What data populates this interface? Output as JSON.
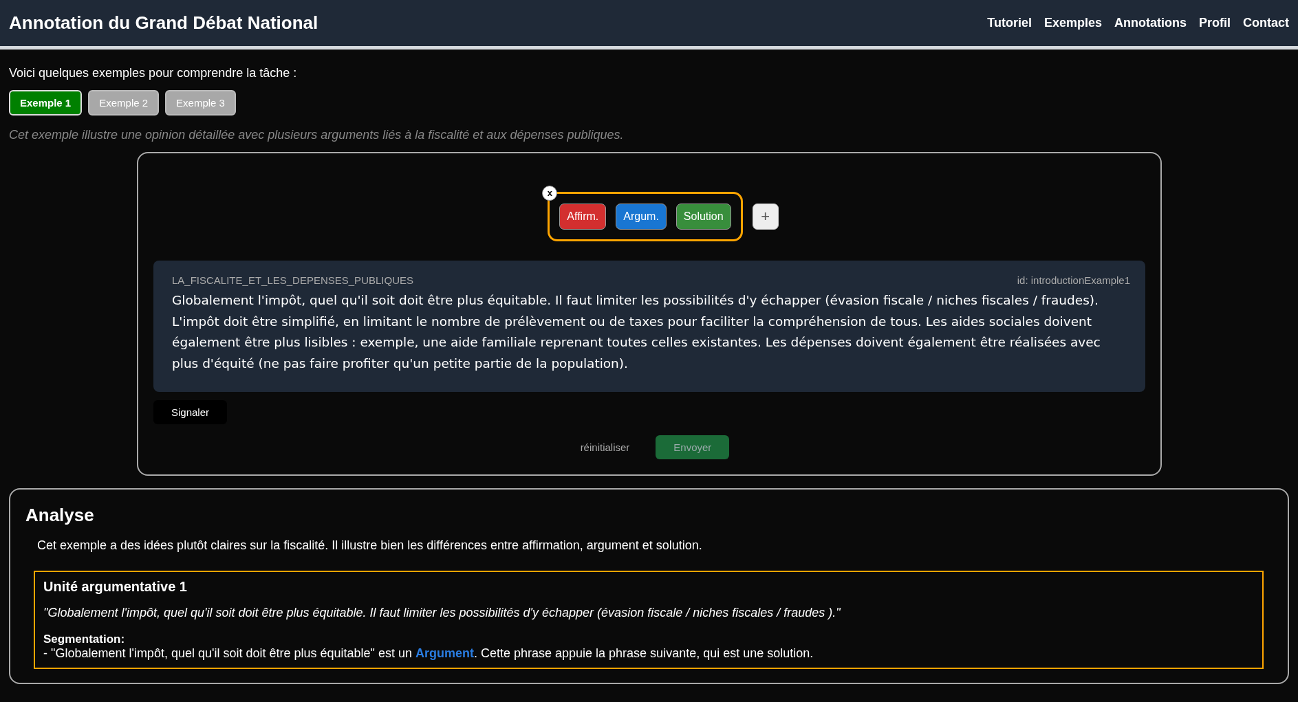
{
  "header": {
    "title": "Annotation du Grand Débat National",
    "nav": [
      "Tutoriel",
      "Exemples",
      "Annotations",
      "Profil",
      "Contact"
    ]
  },
  "intro": "Voici quelques exemples pour comprendre la tâche :",
  "examples": [
    {
      "label": "Exemple 1",
      "selected": true
    },
    {
      "label": "Exemple 2",
      "selected": false
    },
    {
      "label": "Exemple 3",
      "selected": false
    }
  ],
  "description": "Cet exemple illustre une opinion détaillée avec plusieurs arguments liés à la fiscalité et aux dépenses publiques.",
  "annotator": {
    "close": "x",
    "labels": [
      {
        "label": "Affirm.",
        "color": "#d32f2f"
      },
      {
        "label": "Argum.",
        "color": "#1976d2"
      },
      {
        "label": "Solution",
        "color": "#388e3c"
      }
    ],
    "add": "+",
    "category": "LA_FISCALITE_ET_LES_DEPENSES_PUBLIQUES",
    "id": "id: introductionExample1",
    "text": "Globalement l'impôt, quel qu'il soit doit être plus équitable. Il faut limiter les possibilités d'y échapper (évasion fiscale / niches fiscales / fraudes). L'impôt doit être simplifié, en limitant le nombre de prélèvement ou de taxes pour faciliter la compréhension de tous. Les aides sociales doivent également être plus lisibles : exemple, une aide familiale reprenant toutes celles existantes. Les dépenses doivent également être réalisées avec plus d'équité (ne pas faire profiter qu'un petite partie de la population).",
    "report": "Signaler",
    "reset": "réinitialiser",
    "submit": {
      "label": "Envoyer",
      "disabled": true
    }
  },
  "analysis": {
    "title": "Analyse",
    "summary": "Cet exemple a des idées plutôt claires sur la fiscalité. Il illustre bien les différences entre affirmation, argument et solution.",
    "units": [
      {
        "title": "Unité argumentative 1",
        "quote": "\"Globalement l'impôt, quel qu'il soit doit être plus équitable. Il faut limiter les possibilités d'y échapper (évasion fiscale / niches fiscales / fraudes ).\"",
        "segmentation_label": "Segmentation:",
        "segments": [
          {
            "before": "- \"Globalement l'impôt, quel qu'il soit doit être plus équitable\" est un",
            "link": "Argument",
            "after": ". Cette phrase appuie la phrase suivante, qui est une solution."
          }
        ]
      }
    ]
  }
}
